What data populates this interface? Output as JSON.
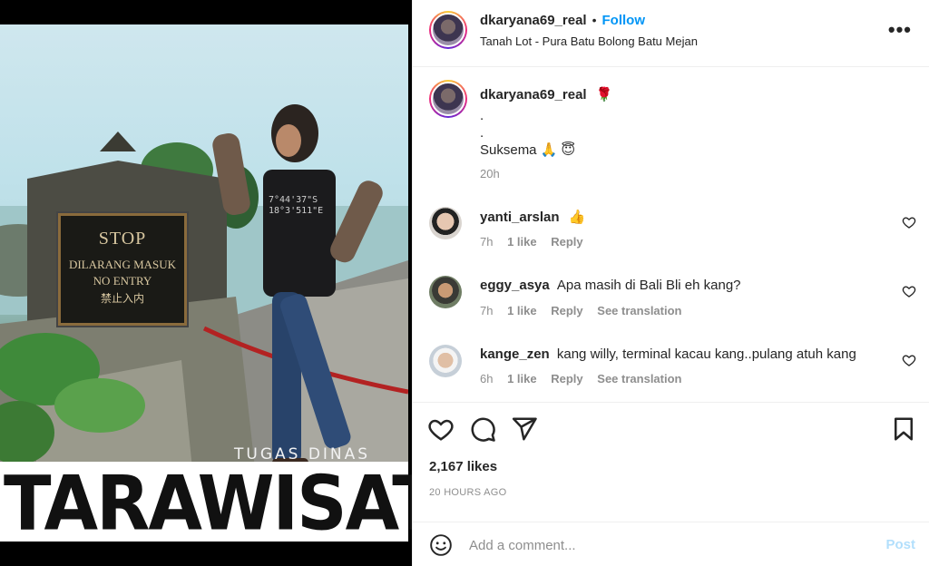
{
  "post": {
    "username": "dkaryana69_real",
    "follow_label": "Follow",
    "location": "Tanah Lot - Pura Batu Bolong Batu Mejan",
    "more_label": "•••"
  },
  "media": {
    "sign": {
      "line1": "STOP",
      "line2": "DILARANG MASUK",
      "line3": "NO ENTRY",
      "line4": "禁止入内"
    },
    "shirt_text": "7°44'37\"S 18°3'511\"E",
    "overlay_small": "TUGAS DINAS",
    "overlay_big": "TARAWISATA"
  },
  "caption": {
    "username": "dkaryana69_real",
    "emoji": "🌹",
    "line1": ".",
    "line2": ".",
    "line3": "Suksema 🙏 😇",
    "time": "20h"
  },
  "comments": [
    {
      "username": "yanti_arslan",
      "text": "👍",
      "time": "7h",
      "likes": "1 like",
      "reply": "Reply",
      "translate": ""
    },
    {
      "username": "eggy_asya",
      "text": "Apa masih di Bali Bli eh kang?",
      "time": "7h",
      "likes": "1 like",
      "reply": "Reply",
      "translate": "See translation"
    },
    {
      "username": "kange_zen",
      "text": "kang willy, terminal kacau kang..pulang atuh kang",
      "time": "6h",
      "likes": "1 like",
      "reply": "Reply",
      "translate": "See translation"
    }
  ],
  "stats": {
    "likes": "2,167 likes",
    "ago": "20 HOURS AGO"
  },
  "composer": {
    "placeholder": "Add a comment...",
    "post_label": "Post"
  },
  "colors": {
    "link": "#0095f6",
    "muted": "#8e8e8e",
    "text": "#262626"
  }
}
